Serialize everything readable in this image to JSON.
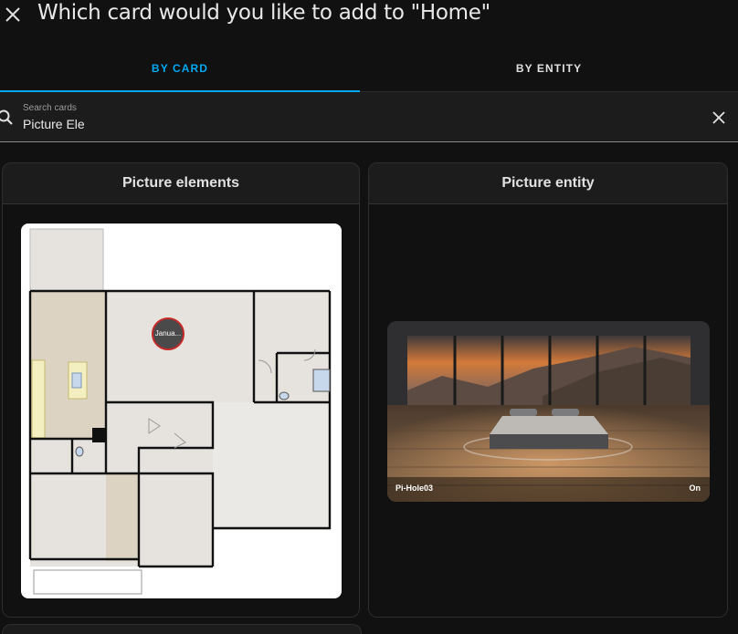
{
  "dialog": {
    "title": "Which card would you like to add to \"Home\"",
    "close_icon": "close-icon"
  },
  "tabs": [
    {
      "label": "BY CARD",
      "active": true
    },
    {
      "label": "BY ENTITY",
      "active": false
    }
  ],
  "search": {
    "label": "Search cards",
    "value": "Picture Ele",
    "search_icon": "search-icon",
    "clear_icon": "clear-icon"
  },
  "cards": [
    {
      "title": "Picture elements",
      "preview": {
        "type": "floorplan",
        "badge_text": "Janua..."
      }
    },
    {
      "title": "Picture entity",
      "preview": {
        "type": "bedroom-photo",
        "entity_name": "Pi-Hole03",
        "entity_state": "On"
      }
    }
  ],
  "colors": {
    "accent": "#03a9f4",
    "background": "#111111",
    "card": "#1c1c1c",
    "badge_border": "#c62828"
  }
}
